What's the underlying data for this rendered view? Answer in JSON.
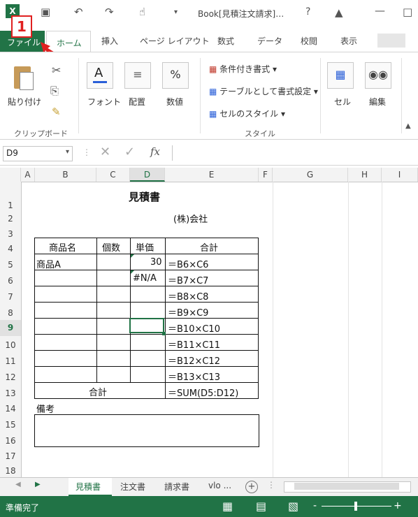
{
  "window": {
    "title": "Book[見積注文請求]…",
    "help": "?"
  },
  "annotation": {
    "number": "1"
  },
  "tabs": [
    "ファイル",
    "ホーム",
    "挿入",
    "ページ レイアウト",
    "数式",
    "データ",
    "校閲",
    "表示"
  ],
  "ribbon": {
    "paste": "貼り付け",
    "font": "フォント",
    "align": "配置",
    "number": "数値",
    "cond_format": "条件付き書式",
    "table_format": "テーブルとして書式設定",
    "cell_style": "セルのスタイル",
    "cells": "セル",
    "edit": "編集",
    "group_clipboard": "クリップボード",
    "group_style": "スタイル"
  },
  "formula_bar": {
    "name_box": "D9",
    "fx": "fx",
    "value": ""
  },
  "columns": [
    "A",
    "B",
    "C",
    "D",
    "E",
    "F",
    "G",
    "H",
    "I"
  ],
  "rows": [
    "1",
    "2",
    "3",
    "4",
    "5",
    "6",
    "7",
    "8",
    "9",
    "10",
    "11",
    "12",
    "13",
    "14",
    "15",
    "16",
    "17",
    "18"
  ],
  "sheet": {
    "title": "見積書",
    "company": "(株)会社",
    "headers": [
      "商品名",
      "個数",
      "単価",
      "合計"
    ],
    "b5": "商品A",
    "d5": "30",
    "d6": "#N/A",
    "formulas": [
      "＝B6×C6",
      "＝B7×C7",
      "＝B8×C8",
      "＝B9×C9",
      "＝B10×C10",
      "＝B11×C11",
      "＝B12×C12",
      "＝B13×C13"
    ],
    "total_label": "合計",
    "total_formula": "＝SUM(D5:D12)",
    "notes": "備考"
  },
  "sheet_tabs": [
    "見積書",
    "注文書",
    "請求書",
    "vlo ..."
  ],
  "status": {
    "text": "準備完了",
    "zoom_minus": "-",
    "zoom_plus": "+"
  }
}
